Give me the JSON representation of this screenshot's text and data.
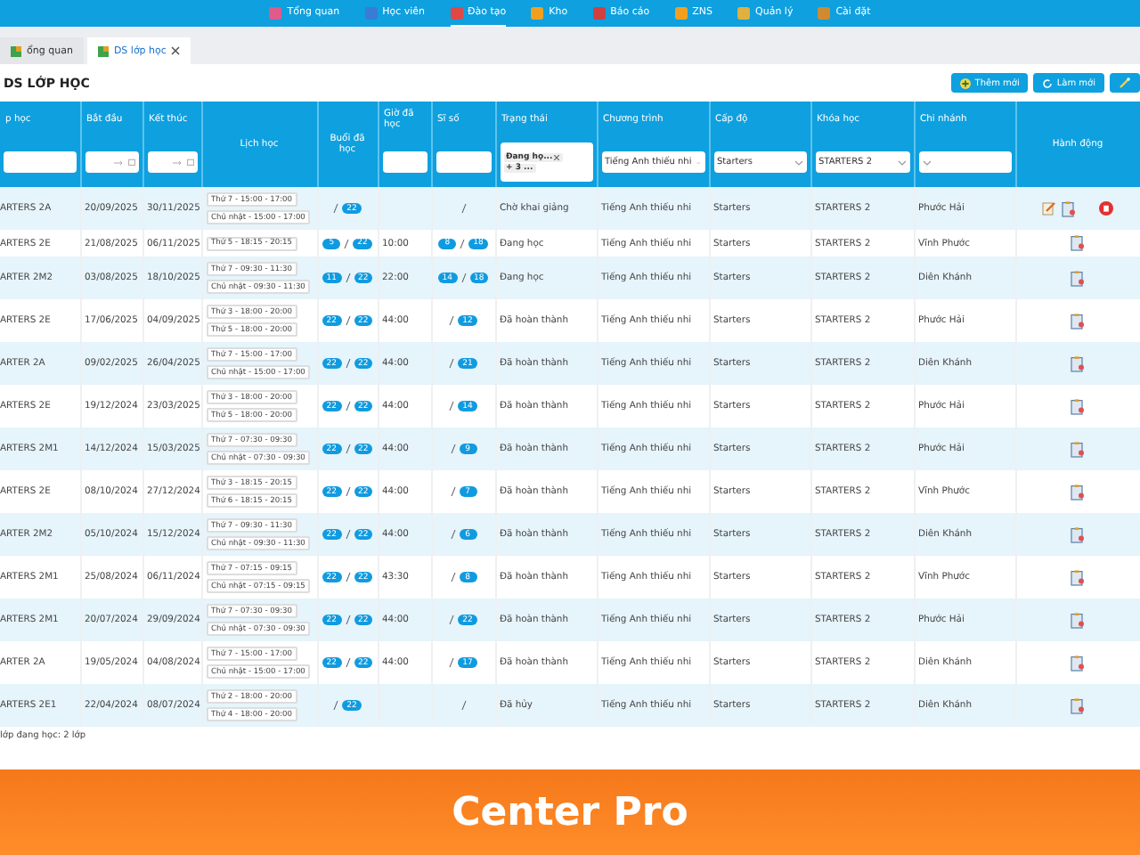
{
  "top_nav": [
    {
      "label": "Tổng quan",
      "selected": false,
      "color": "#e05a8a"
    },
    {
      "label": "Học viên",
      "selected": false,
      "color": "#3a7bd5"
    },
    {
      "label": "Đào tạo",
      "selected": true,
      "color": "#e04848"
    },
    {
      "label": "Kho",
      "selected": false,
      "color": "#f0a020"
    },
    {
      "label": "Báo cáo",
      "selected": false,
      "color": "#d04040"
    },
    {
      "label": "ZNS",
      "selected": false,
      "color": "#f0a020"
    },
    {
      "label": "Quản lý",
      "selected": false,
      "color": "#e0b040"
    },
    {
      "label": "Cài đặt",
      "selected": false,
      "color": "#d08a30"
    }
  ],
  "tabs": [
    {
      "label": "ổng quan",
      "selected": false,
      "closable": false
    },
    {
      "label": "DS lớp học",
      "selected": true,
      "closable": true
    }
  ],
  "page_title": "DS LỚP HỌC",
  "toolbar": [
    {
      "kind": "add",
      "label": "Thêm mới"
    },
    {
      "kind": "refresh",
      "label": "Làm mới"
    },
    {
      "kind": "magic"
    }
  ],
  "columns": [
    "p học",
    "Bắt đầu",
    "Kết thúc",
    "Lịch học",
    "Buổi đã học",
    "Giờ đã học",
    "Sĩ số",
    "Trạng thái",
    "Chương trình",
    "Cấp độ",
    "Khóa học",
    "Chi nhánh",
    "Hành động"
  ],
  "filters": [
    {
      "kind": "text"
    },
    {
      "kind": "date"
    },
    {
      "kind": "date"
    },
    {
      "kind": "none"
    },
    {
      "kind": "none"
    },
    {
      "kind": "text"
    },
    {
      "kind": "text"
    },
    {
      "kind": "tags",
      "tags": [
        "Đang họ...",
        "+ 3 ..."
      ]
    },
    {
      "kind": "select",
      "value": "Tiếng Anh thiếu nhi"
    },
    {
      "kind": "select",
      "value": "Starters"
    },
    {
      "kind": "select",
      "value": "STARTERS 2"
    },
    {
      "kind": "select"
    },
    {
      "kind": "none"
    }
  ],
  "rows": [
    {
      "name": "ARTERS 2A",
      "start": "20/09/2025",
      "end": "30/11/2025",
      "schedule": [
        "Thứ 7 - 15:00 - 17:00",
        "Chủ nhật - 15:00 - 17:00"
      ],
      "sessions_total": "22",
      "status": "Chờ khai giảng",
      "program": "Tiếng Anh thiếu nhi",
      "level": "Starters",
      "course": "STARTERS 2",
      "branch": "Phước Hải",
      "actions": [
        {
          "kind": "edit"
        },
        {
          "kind": "document"
        },
        {
          "kind": "delete"
        }
      ]
    },
    {
      "name": "ARTERS 2E",
      "start": "21/08/2025",
      "end": "06/11/2025",
      "schedule": [
        "Thứ 5 - 18:15 - 20:15"
      ],
      "sessions_done": "5",
      "sessions_total": "22",
      "hours": "10:00",
      "size_current": "8",
      "size_max": "18",
      "status": "Đang học",
      "program": "Tiếng Anh thiếu nhi",
      "level": "Starters",
      "course": "STARTERS 2",
      "branch": "Vĩnh Phước",
      "actions": [
        {
          "kind": "document"
        }
      ]
    },
    {
      "name": "ARTER 2M2",
      "start": "03/08/2025",
      "end": "18/10/2025",
      "schedule": [
        "Thứ 7 - 09:30 - 11:30",
        "Chủ nhật - 09:30 - 11:30"
      ],
      "sessions_done": "11",
      "sessions_total": "22",
      "hours": "22:00",
      "size_current": "14",
      "size_max": "18",
      "status": "Đang học",
      "program": "Tiếng Anh thiếu nhi",
      "level": "Starters",
      "course": "STARTERS 2",
      "branch": "Diên Khánh",
      "actions": [
        {
          "kind": "document"
        }
      ]
    },
    {
      "name": "ARTERS 2E",
      "start": "17/06/2025",
      "end": "04/09/2025",
      "schedule": [
        "Thứ 3 - 18:00 - 20:00",
        "Thứ 5 - 18:00 - 20:00"
      ],
      "sessions_done": "22",
      "sessions_total": "22",
      "hours": "44:00",
      "size_max": "12",
      "status": "Đã hoàn thành",
      "program": "Tiếng Anh thiếu nhi",
      "level": "Starters",
      "course": "STARTERS 2",
      "branch": "Phước Hải",
      "actions": [
        {
          "kind": "document"
        }
      ]
    },
    {
      "name": "ARTER 2A",
      "start": "09/02/2025",
      "end": "26/04/2025",
      "schedule": [
        "Thứ 7 - 15:00 - 17:00",
        "Chủ nhật - 15:00 - 17:00"
      ],
      "sessions_done": "22",
      "sessions_total": "22",
      "hours": "44:00",
      "size_max": "21",
      "status": "Đã hoàn thành",
      "program": "Tiếng Anh thiếu nhi",
      "level": "Starters",
      "course": "STARTERS 2",
      "branch": "Diên Khánh",
      "actions": [
        {
          "kind": "document"
        }
      ]
    },
    {
      "name": "ARTERS 2E",
      "start": "19/12/2024",
      "end": "23/03/2025",
      "schedule": [
        "Thứ 3 - 18:00 - 20:00",
        "Thứ 5 - 18:00 - 20:00"
      ],
      "sessions_done": "22",
      "sessions_total": "22",
      "hours": "44:00",
      "size_max": "14",
      "status": "Đã hoàn thành",
      "program": "Tiếng Anh thiếu nhi",
      "level": "Starters",
      "course": "STARTERS 2",
      "branch": "Phước Hải",
      "actions": [
        {
          "kind": "document"
        }
      ]
    },
    {
      "name": "ARTERS 2M1",
      "start": "14/12/2024",
      "end": "15/03/2025",
      "schedule": [
        "Thứ 7 - 07:30 - 09:30",
        "Chủ nhật - 07:30 - 09:30"
      ],
      "sessions_done": "22",
      "sessions_total": "22",
      "hours": "44:00",
      "size_max": "9",
      "status": "Đã hoàn thành",
      "program": "Tiếng Anh thiếu nhi",
      "level": "Starters",
      "course": "STARTERS 2",
      "branch": "Phước Hải",
      "actions": [
        {
          "kind": "document"
        }
      ]
    },
    {
      "name": "ARTERS 2E",
      "start": "08/10/2024",
      "end": "27/12/2024",
      "schedule": [
        "Thứ 3 - 18:15 - 20:15",
        "Thứ 6 - 18:15 - 20:15"
      ],
      "sessions_done": "22",
      "sessions_total": "22",
      "hours": "44:00",
      "size_max": "7",
      "status": "Đã hoàn thành",
      "program": "Tiếng Anh thiếu nhi",
      "level": "Starters",
      "course": "STARTERS 2",
      "branch": "Vĩnh Phước",
      "actions": [
        {
          "kind": "document"
        }
      ]
    },
    {
      "name": "ARTER 2M2",
      "start": "05/10/2024",
      "end": "15/12/2024",
      "schedule": [
        "Thứ 7 - 09:30 - 11:30",
        "Chủ nhật - 09:30 - 11:30"
      ],
      "sessions_done": "22",
      "sessions_total": "22",
      "hours": "44:00",
      "size_max": "6",
      "status": "Đã hoàn thành",
      "program": "Tiếng Anh thiếu nhi",
      "level": "Starters",
      "course": "STARTERS 2",
      "branch": "Diên Khánh",
      "actions": [
        {
          "kind": "document"
        }
      ]
    },
    {
      "name": "ARTERS 2M1",
      "start": "25/08/2024",
      "end": "06/11/2024",
      "schedule": [
        "Thứ 7 - 07:15 - 09:15",
        "Chủ nhật - 07:15 - 09:15"
      ],
      "sessions_done": "22",
      "sessions_total": "22",
      "hours": "43:30",
      "size_max": "8",
      "status": "Đã hoàn thành",
      "program": "Tiếng Anh thiếu nhi",
      "level": "Starters",
      "course": "STARTERS 2",
      "branch": "Vĩnh Phước",
      "actions": [
        {
          "kind": "document"
        }
      ]
    },
    {
      "name": "ARTERS 2M1",
      "start": "20/07/2024",
      "end": "29/09/2024",
      "schedule": [
        "Thứ 7 - 07:30 - 09:30",
        "Chủ nhật - 07:30 - 09:30"
      ],
      "sessions_done": "22",
      "sessions_total": "22",
      "hours": "44:00",
      "size_max": "22",
      "status": "Đã hoàn thành",
      "program": "Tiếng Anh thiếu nhi",
      "level": "Starters",
      "course": "STARTERS 2",
      "branch": "Phước Hải",
      "actions": [
        {
          "kind": "document"
        }
      ]
    },
    {
      "name": "ARTER 2A",
      "start": "19/05/2024",
      "end": "04/08/2024",
      "schedule": [
        "Thứ 7 - 15:00 - 17:00",
        "Chủ nhật - 15:00 - 17:00"
      ],
      "sessions_done": "22",
      "sessions_total": "22",
      "hours": "44:00",
      "size_max": "17",
      "status": "Đã hoàn thành",
      "program": "Tiếng Anh thiếu nhi",
      "level": "Starters",
      "course": "STARTERS 2",
      "branch": "Diên Khánh",
      "actions": [
        {
          "kind": "document"
        }
      ]
    },
    {
      "name": "ARTERS 2E1",
      "start": "22/04/2024",
      "end": "08/07/2024",
      "schedule": [
        "Thứ 2 - 18:00 - 20:00",
        "Thứ 4 - 18:00 - 20:00"
      ],
      "sessions_total": "22",
      "status": "Đã hủy",
      "program": "Tiếng Anh thiếu nhi",
      "level": "Starters",
      "course": "STARTERS 2",
      "branch": "Diên Khánh",
      "actions": [
        {
          "kind": "document"
        }
      ]
    }
  ],
  "summary": "lớp đang học: 2 lớp",
  "banner": {
    "title": "Center Pro"
  }
}
